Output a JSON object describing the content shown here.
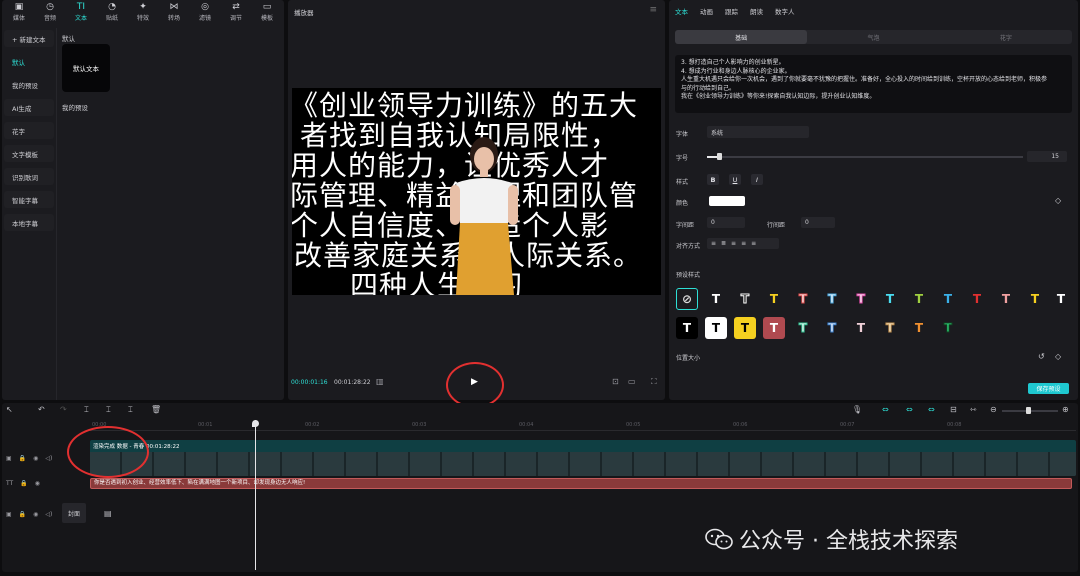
{
  "toolbar": {
    "items": [
      {
        "icon": "media-icon",
        "label": "媒体"
      },
      {
        "icon": "audio-icon",
        "label": "音频"
      },
      {
        "icon": "text-icon",
        "label": "文本"
      },
      {
        "icon": "sticker-icon",
        "label": "贴纸"
      },
      {
        "icon": "effects-icon",
        "label": "特效"
      },
      {
        "icon": "transition-icon",
        "label": "转场"
      },
      {
        "icon": "filter-icon",
        "label": "滤镜"
      },
      {
        "icon": "adjust-icon",
        "label": "调节"
      },
      {
        "icon": "template-icon",
        "label": "模板"
      }
    ]
  },
  "sidenav": {
    "items": [
      "+ 新建文本",
      "默认",
      "我的预设",
      "AI生成",
      "花字",
      "文字模板",
      "识别歌词",
      "智能字幕",
      "本地字幕"
    ]
  },
  "left_content": {
    "section_default": "默认",
    "default_tile": "默认文本",
    "section_presets": "我的预设"
  },
  "player": {
    "title": "播放器",
    "time_current": "00:00:01:16",
    "time_total": "00:01:28:22",
    "video_lines": [
      "《创业领导力训练》的五大",
      "者找到自我认知局限性，",
      "用人的能力，让优秀人才",
      "际管理、精益管理和团队管",
      "个人自信度、打造个人影",
      "改善家庭关系和人际关系。",
      "四种人生学习"
    ]
  },
  "props": {
    "tabs": [
      "文本",
      "动画",
      "跟踪",
      "朗读",
      "数字人"
    ],
    "subtabs": [
      "基础",
      "气泡",
      "花字"
    ],
    "text_content": [
      "3. 想打造自己个人影响力的创业新星。",
      "4. 想成为行业和身边人脉核心的企业家。",
      "人生重大机遇只会给你一次机会，遇到了你就要毫不犹豫的把握住。准备好，全心投入的时间给到训练，空杯开放的心态给到老师，积极参",
      "与的行动给到自己。",
      "我在《创业领导力训练》等你来!探索自我认知边际，提升创业认知维度。"
    ],
    "font_label": "字体",
    "font_value": "系统",
    "size_label": "字号",
    "size_value": "15",
    "style_label": "样式",
    "color_label": "颜色",
    "spacing_label": "字间距",
    "spacing_value": "0",
    "line_spacing_label": "行间距",
    "line_spacing_value": "0",
    "align_label": "对齐方式",
    "preset_label": "预设样式",
    "position_label": "位置大小",
    "save_preset": "保存预设"
  },
  "timeline": {
    "ruler_ticks": [
      "00:00",
      "00:01",
      "00:02",
      "00:03",
      "00:04",
      "00:05",
      "00:06",
      "00:07",
      "00:08"
    ],
    "video_clip_label": "渲染完成  数据 - 青春  00:01:28:22",
    "text_clip": "你是否遇到初入创业、经营效率低下、陷在满满地图一个新项目、却发现身边无人响应!",
    "cover_label": "封面"
  },
  "watermark": "公众号 · 全栈技术探索",
  "colors": {
    "accent": "#2ee0d6",
    "save": "#1fc8d0",
    "text_clip": "#8a3a3a",
    "annotation": "#e23030"
  }
}
